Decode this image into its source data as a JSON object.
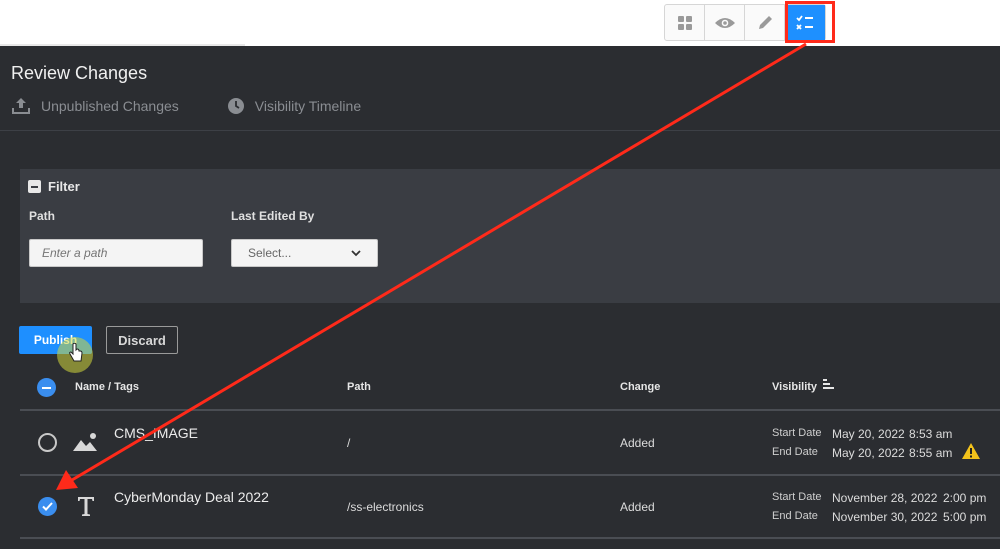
{
  "page": {
    "title": "Review Changes",
    "tabs": [
      {
        "label": "Unpublished Changes",
        "icon": "upload-icon"
      },
      {
        "label": "Visibility Timeline",
        "icon": "clock-icon"
      }
    ]
  },
  "toolbar": {
    "buttons": [
      {
        "icon": "grid-icon"
      },
      {
        "icon": "eye-icon"
      },
      {
        "icon": "pencil-icon"
      },
      {
        "icon": "review-checklist-icon",
        "active": true
      }
    ]
  },
  "filter": {
    "title": "Filter",
    "path_label": "Path",
    "path_placeholder": "Enter a path",
    "edited_by_label": "Last Edited By",
    "edited_by_value": "Select..."
  },
  "actions": {
    "publish": "Publish",
    "discard": "Discard"
  },
  "table": {
    "headers": {
      "name": "Name / Tags",
      "path": "Path",
      "change": "Change",
      "visibility": "Visibility"
    },
    "rows": [
      {
        "name": "CMS_IMAGE",
        "type_icon": "image-icon",
        "path": "/",
        "change": "Added",
        "start_label": "Start Date",
        "start_date": "May 20, 2022",
        "start_time": "8:53 am",
        "end_label": "End Date",
        "end_date": "May 20, 2022",
        "end_time": "8:55 am",
        "warning": true,
        "selected": false
      },
      {
        "name": "CyberMonday Deal 2022",
        "type_icon": "text-icon",
        "path": "/ss-electronics",
        "change": "Added",
        "start_label": "Start Date",
        "start_date": "November 28, 2022",
        "start_time": "2:00 pm",
        "end_label": "End Date",
        "end_date": "November 30, 2022",
        "end_time": "5:00 pm",
        "warning": false,
        "selected": true
      }
    ]
  },
  "colors": {
    "accent": "#1e8fff",
    "annotation": "#ff2a1a",
    "background": "#2b2d31"
  }
}
